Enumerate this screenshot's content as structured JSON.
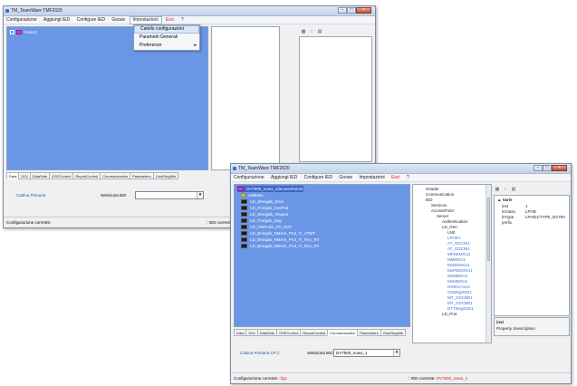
{
  "back": {
    "title": "TM_TeamWare TMF2020",
    "menu": [
      "Configurazione",
      "Aggiungi IED",
      "Configure IED",
      "Goose",
      "Impostazioni",
      "Esci",
      "?"
    ],
    "tree_root": "Nodo3",
    "dropdown": [
      "Catello configurazioni",
      "Parametri Generali",
      "Preferenze"
    ],
    "tabs": [
      "Data",
      "DOI",
      "DataSets",
      "GSEControl",
      "ReportControl",
      "Communication",
      "Parameters",
      "Gnd/Seg/Me"
    ],
    "cabina_label": "Cabina Primaria",
    "seleziona_label": "Seleziona IED",
    "status_left": "Configurazione corrente:",
    "status_right": "IED corrente:"
  },
  "front": {
    "title": "TM_TeamWare TMF2020",
    "menu": [
      "Configurazione",
      "Aggiungi IED",
      "Configure IED",
      "Goose",
      "Impostazioni",
      "Esci",
      "?"
    ],
    "nodes": [
      "DV7500_nowo_1/accessPoint1",
      "Address",
      "LD_Sbmgab_Emd",
      "LD_Protgub_AovPod",
      "LD_Sbmgab_Ongani",
      "LD_Protgub_Seg",
      "LD_FWProth_PO_RAT",
      "LD_Bmrgab_NMAm_Prot_Tr_ATMT",
      "LD_Bmrgab_NMAm_Prot_Tr_Rec_RT",
      "LD_Bmrgab_NMAm_Prot_Tr_Rec_RT"
    ],
    "tree": [
      "Header",
      "Communication",
      "IED",
      "Services",
      "AccessPoint",
      "Server",
      "Authentication",
      "LD_Gen",
      "LN0",
      "LPHD1",
      "AT_GDCNI1",
      "AT_GDCNI1",
      "MFDEMXU1",
      "MMMXU1",
      "MvDEMXU1",
      "MvPDEMXU1",
      "MvMMXU1",
      "MvMMXU1",
      "OrRECALV1",
      "ODMng0SD1",
      "MT_GDCBR1",
      "MT_GDCBR1",
      "DTTMng0SD1",
      "LD_Prot"
    ],
    "props_header": "Varie",
    "props": [
      {
        "k": "inst",
        "v": "1"
      },
      {
        "k": "lnClass",
        "v": "LPHD"
      },
      {
        "k": "lnType",
        "v": "LPHD1/TYPE_DV750"
      },
      {
        "k": "prefix",
        "v": ""
      }
    ],
    "desc_title": "inst",
    "desc_text": "Property Ssescription",
    "tabs": [
      "Data",
      "DOI",
      "DataSets",
      "GSEControl",
      "ReportControl",
      "Communication",
      "Parameters",
      "Gnd/Seg/Me"
    ],
    "cabina_label": "Cabina Primaria CP:1",
    "seleziona_label": "Seleziona IED",
    "ied_selected": "DV7500_nowo_1",
    "status_left": "Configurazione corrente:",
    "status_left_val": "cfg1",
    "status_right": "IED corrente:",
    "status_right_val": "DV7500_nowo_1"
  }
}
